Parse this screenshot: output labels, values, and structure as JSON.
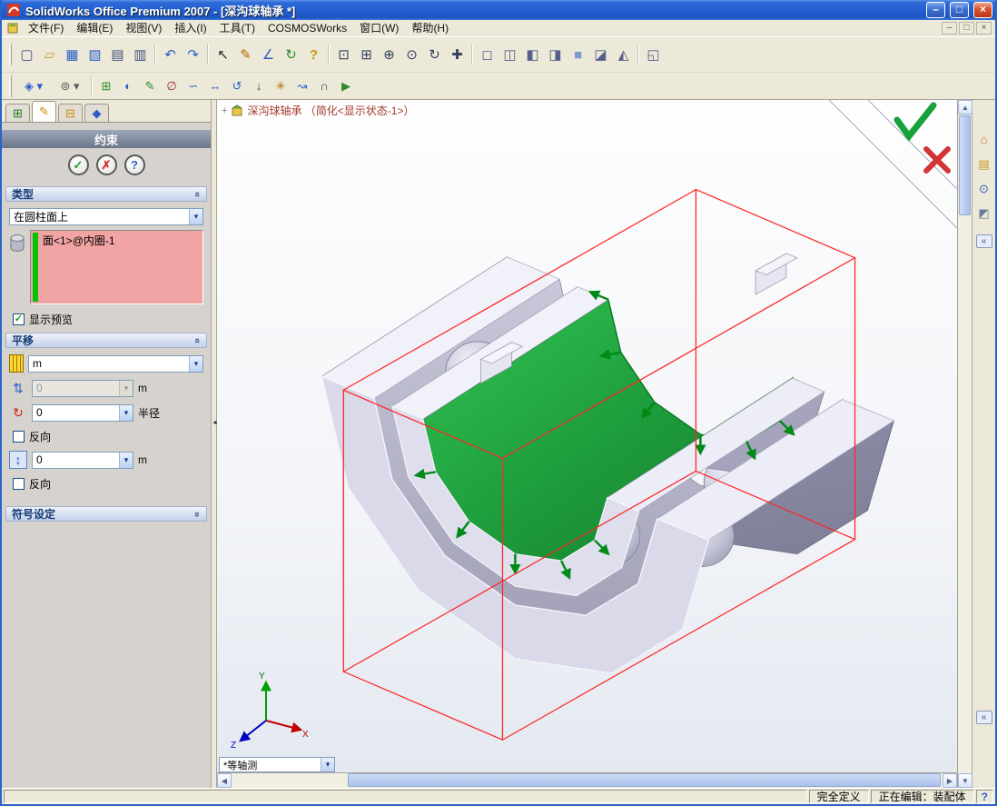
{
  "colors": {
    "titlebar_blue": "#2A63C9",
    "toolbar_bg": "#ECE9D8",
    "selection_pink": "#F2A3A3",
    "selection_green_bar": "#00C400",
    "selected_face_green": "#1E9E3C",
    "preview_wireframe_red": "#FF2626",
    "panel_header_text": "#173C73"
  },
  "window": {
    "title": "SolidWorks Office Premium 2007 - [深沟球轴承 *]",
    "minimize_glyph": "–",
    "maximize_glyph": "□",
    "close_glyph": "×"
  },
  "menu": {
    "items": [
      "文件(F)",
      "编辑(E)",
      "视图(V)",
      "插入(I)",
      "工具(T)",
      "COSMOSWorks",
      "窗口(W)",
      "帮助(H)"
    ],
    "mdi_minimize": "–",
    "mdi_restore": "□",
    "mdi_close": "×"
  },
  "toolbar1": {
    "items": [
      {
        "name": "new-document",
        "glyph": "▢",
        "style": "color:#44507A",
        "cls": "tbtn",
        "inter": "true"
      },
      {
        "name": "open",
        "glyph": "▱",
        "style": "color:#C9971F",
        "cls": "tbtn",
        "inter": "true"
      },
      {
        "name": "save",
        "glyph": "▦",
        "style": "color:#2B5FC7",
        "cls": "tbtn",
        "inter": "true"
      },
      {
        "name": "save-all",
        "glyph": "▧",
        "style": "color:#2B5FC7",
        "cls": "tbtn",
        "inter": "true"
      },
      {
        "name": "print",
        "glyph": "▤",
        "style": "color:#44507A",
        "cls": "tbtn",
        "inter": "true"
      },
      {
        "name": "print-preview",
        "glyph": "▥",
        "style": "color:#44507A",
        "cls": "tbtn",
        "inter": "true"
      },
      {
        "name": "separator",
        "glyph": "",
        "style": "",
        "cls": "tsep",
        "inter": "false"
      },
      {
        "name": "undo",
        "glyph": "↶",
        "style": "color:#2B5FC7",
        "cls": "tbtn",
        "inter": "true"
      },
      {
        "name": "redo",
        "glyph": "↷",
        "style": "color:#2B5FC7",
        "cls": "tbtn",
        "inter": "true"
      },
      {
        "name": "separator",
        "glyph": "",
        "style": "",
        "cls": "tsep",
        "inter": "false"
      },
      {
        "name": "select",
        "glyph": "↖",
        "style": "color:#222222",
        "cls": "tbtn",
        "inter": "true"
      },
      {
        "name": "sketch",
        "glyph": "✎",
        "style": "color:#B06A00",
        "cls": "tbtn",
        "inter": "true"
      },
      {
        "name": "smart-dimension",
        "glyph": "∠",
        "style": "color:#2B5FC7",
        "cls": "tbtn",
        "inter": "true"
      },
      {
        "name": "rebuild",
        "glyph": "↻",
        "style": "color:#2E8B2E",
        "cls": "tbtn",
        "inter": "true"
      },
      {
        "name": "options",
        "glyph": "?",
        "style": "color:#C99700;font-weight:bold",
        "cls": "tbtn",
        "inter": "true"
      },
      {
        "name": "separator",
        "glyph": "",
        "style": "",
        "cls": "tsep",
        "inter": "false"
      },
      {
        "name": "zoom-to-fit",
        "glyph": "⊡",
        "style": "color:#35425E",
        "cls": "tbtn",
        "inter": "true"
      },
      {
        "name": "zoom-to-area",
        "glyph": "⊞",
        "style": "color:#35425E",
        "cls": "tbtn",
        "inter": "true"
      },
      {
        "name": "zoom-in-out",
        "glyph": "⊕",
        "style": "color:#35425E",
        "cls": "tbtn",
        "inter": "true"
      },
      {
        "name": "zoom-to-selection",
        "glyph": "⊙",
        "style": "color:#35425E",
        "cls": "tbtn",
        "inter": "true"
      },
      {
        "name": "rotate-view",
        "glyph": "↻",
        "style": "color:#35425E",
        "cls": "tbtn",
        "inter": "true"
      },
      {
        "name": "pan",
        "glyph": "✚",
        "style": "color:#35425E",
        "cls": "tbtn",
        "inter": "true"
      },
      {
        "name": "separator",
        "glyph": "",
        "style": "",
        "cls": "tsep",
        "inter": "false"
      },
      {
        "name": "wireframe",
        "glyph": "◻",
        "style": "color:#56618A",
        "cls": "tbtn",
        "inter": "true"
      },
      {
        "name": "hidden-lines-visible",
        "glyph": "◫",
        "style": "color:#56618A",
        "cls": "tbtn",
        "inter": "true"
      },
      {
        "name": "hidden-lines-removed",
        "glyph": "◧",
        "style": "color:#56618A",
        "cls": "tbtn",
        "inter": "true"
      },
      {
        "name": "shaded-with-edges",
        "glyph": "◨",
        "style": "color:#56618A",
        "cls": "tbtn",
        "inter": "true"
      },
      {
        "name": "shaded",
        "glyph": "■",
        "style": "color:#7A9CD0",
        "cls": "tbtn",
        "inter": "true"
      },
      {
        "name": "shadows-in-shaded-mode",
        "glyph": "◪",
        "style": "color:#56618A",
        "cls": "tbtn",
        "inter": "true"
      },
      {
        "name": "section-view",
        "glyph": "◭",
        "style": "color:#56618A",
        "cls": "tbtn",
        "inter": "true"
      },
      {
        "name": "separator",
        "glyph": "",
        "style": "",
        "cls": "tsep",
        "inter": "false"
      },
      {
        "name": "standard-views",
        "glyph": "◱",
        "style": "color:#56618A",
        "cls": "tbtn",
        "inter": "true"
      }
    ]
  },
  "toolbar2": {
    "items": [
      {
        "name": "command-manager-dropdown",
        "glyph": "◈ ▾",
        "style": "color:#2B5FC7",
        "cls": "tbtn wide",
        "inter": "true"
      },
      {
        "name": "selection-filter-dropdown",
        "glyph": "⊚ ▾",
        "style": "color:#5A5A5A",
        "cls": "tbtn wide",
        "inter": "true"
      },
      {
        "name": "separator",
        "glyph": "",
        "style": "",
        "cls": "tsep",
        "inter": "false"
      },
      {
        "name": "insert-components",
        "glyph": "⊞",
        "style": "color:#2E8B2E",
        "cls": "tbtn",
        "inter": "true"
      },
      {
        "name": "hide-show-components",
        "glyph": "◐",
        "style": "color:#2B5FC7",
        "cls": "tbtn",
        "inter": "true"
      },
      {
        "name": "edit-component",
        "glyph": "✎",
        "style": "color:#2E8B2E",
        "cls": "tbtn",
        "inter": "true"
      },
      {
        "name": "no-external-references",
        "glyph": "∅",
        "style": "color:#A03030",
        "cls": "tbtn",
        "inter": "true"
      },
      {
        "name": "mate",
        "glyph": "∽",
        "style": "color:#2B5FC7",
        "cls": "tbtn",
        "inter": "true"
      },
      {
        "name": "move-component",
        "glyph": "↔",
        "style": "color:#2B5FC7",
        "cls": "tbtn",
        "inter": "true"
      },
      {
        "name": "rotate-component",
        "glyph": "↺",
        "style": "color:#2B5FC7",
        "cls": "tbtn",
        "inter": "true"
      },
      {
        "name": "smart-fasteners",
        "glyph": "↓",
        "style": "color:#35425E",
        "cls": "tbtn",
        "inter": "true"
      },
      {
        "name": "exploded-view",
        "glyph": "✳",
        "style": "color:#B06A00",
        "cls": "tbtn",
        "inter": "true"
      },
      {
        "name": "explode-line-sketch",
        "glyph": "↝",
        "style": "color:#2B5FC7",
        "cls": "tbtn",
        "inter": "true"
      },
      {
        "name": "interference-detection",
        "glyph": "∩",
        "style": "color:#35425E",
        "cls": "tbtn",
        "inter": "true"
      },
      {
        "name": "simulation",
        "glyph": "▶",
        "style": "color:#2E8B2E",
        "cls": "tbtn",
        "inter": "true"
      }
    ]
  },
  "panel": {
    "tabs": [
      {
        "name": "feature-manager-tab",
        "glyph": "⊞",
        "style": "color:#1F7A1F",
        "cls": "ptab",
        "inter": "true"
      },
      {
        "name": "property-manager-tab",
        "glyph": "✎",
        "style": "color:#C98A00",
        "cls": "ptab active",
        "inter": "true"
      },
      {
        "name": "configuration-manager-tab",
        "glyph": "⊟",
        "style": "color:#C98A00",
        "cls": "ptab",
        "inter": "true"
      },
      {
        "name": "third-party-tab",
        "glyph": "◆",
        "style": "color:#2B5FC7",
        "cls": "ptab",
        "inter": "true"
      }
    ],
    "title": "约束",
    "ok_glyph": "✓",
    "cancel_glyph": "✗",
    "help_glyph": "?",
    "type_section": {
      "label": "类型",
      "combo_value": "在圆柱面上",
      "selection": "面<1>@内圈-1",
      "preview_label": "显示预览"
    },
    "translate_section": {
      "label": "平移",
      "unit_value": "m",
      "dist_value": "0",
      "dist_unit": "m",
      "radius_value": "0",
      "radius_unit": "半径",
      "reverse1_label": "反向",
      "axis_value": "0",
      "axis_unit": "m",
      "reverse2_label": "反向"
    },
    "symbol_section": {
      "label": "符号设定"
    }
  },
  "viewport": {
    "plus_glyph": "+",
    "doc_label": "深沟球轴承 （简化<显示状态-1>）",
    "view_selector": "*等轴测",
    "axis_x": "X",
    "axis_y": "Y",
    "axis_z": "Z"
  },
  "taskpane": {
    "items": [
      {
        "name": "solidworks-resources",
        "glyph": "⌂",
        "style": "color:#D2691E",
        "cls": "tpbtn",
        "inter": "true"
      },
      {
        "name": "design-library",
        "glyph": "▤",
        "style": "color:#C9971F",
        "cls": "tpbtn",
        "inter": "true"
      },
      {
        "name": "file-explorer",
        "glyph": "⊙",
        "style": "color:#2B5FC7",
        "cls": "tpbtn",
        "inter": "true"
      },
      {
        "name": "view-palette",
        "glyph": "◩",
        "style": "color:#6B7B9E",
        "cls": "tpbtn",
        "inter": "true"
      }
    ]
  },
  "ui": {
    "dd": "▾",
    "chevron": "«",
    "check": "✓",
    "up": "▲",
    "down": "▼",
    "left": "◀",
    "right": "▶",
    "split_left": "◄"
  },
  "statusbar": {
    "state": "完全定义",
    "editing": "正在编辑：装配体",
    "help_glyph": "?"
  }
}
